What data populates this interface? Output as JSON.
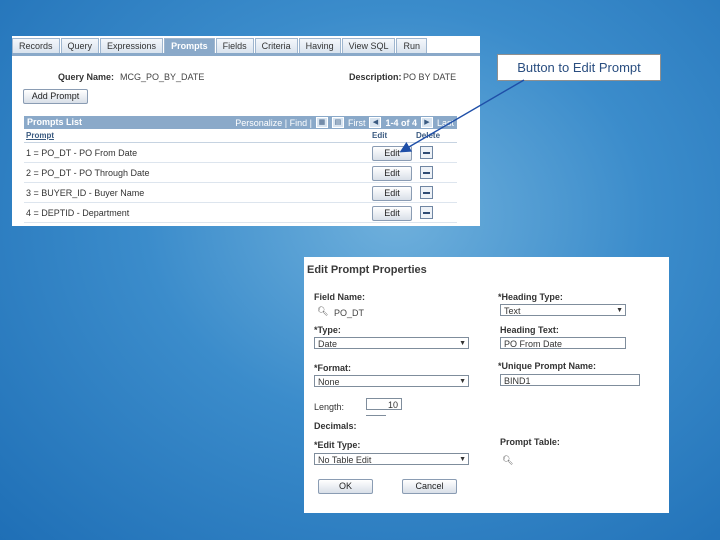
{
  "query_panel": {
    "tabs": [
      {
        "label": "Records",
        "active": false
      },
      {
        "label": "Query",
        "active": false
      },
      {
        "label": "Expressions",
        "active": false
      },
      {
        "label": "Prompts",
        "active": true
      },
      {
        "label": "Fields",
        "active": false
      },
      {
        "label": "Criteria",
        "active": false
      },
      {
        "label": "Having",
        "active": false
      },
      {
        "label": "View SQL",
        "active": false
      },
      {
        "label": "Run",
        "active": false
      }
    ],
    "query_name_label": "Query Name:",
    "query_name_value": "MCG_PO_BY_DATE",
    "description_label": "Description:",
    "description_value": "PO BY DATE",
    "add_prompt_label": "Add Prompt",
    "grid": {
      "title": "Prompts List",
      "personalize": "Personalize | Find |",
      "first": "First",
      "counter": "1-4 of 4",
      "last": "Last",
      "col_prompt": "Prompt",
      "col_edit": "Edit",
      "col_delete": "Delete",
      "edit_label": "Edit",
      "rows": [
        "1 = PO_DT - PO From Date",
        "2 = PO_DT - PO Through Date",
        "3 = BUYER_ID - Buyer Name",
        "4 = DEPTID - Department"
      ]
    }
  },
  "callout": {
    "text": "Button to Edit Prompt"
  },
  "edit_prompt": {
    "title": "Edit Prompt Properties",
    "field_name_label": "Field Name:",
    "field_name_value": "PO_DT",
    "heading_type_label": "*Heading Type:",
    "heading_type_value": "Text",
    "type_label": "*Type:",
    "type_value": "Date",
    "heading_text_label": "Heading Text:",
    "heading_text_value": "PO From Date",
    "format_label": "*Format:",
    "format_value": "None",
    "unique_prompt_label": "*Unique Prompt Name:",
    "unique_prompt_value": "BIND1",
    "length_label": "Length:",
    "length_value": "10",
    "decimals_label": "Decimals:",
    "edit_type_label": "*Edit Type:",
    "edit_type_value": "No Table Edit",
    "prompt_table_label": "Prompt Table:",
    "ok_label": "OK",
    "cancel_label": "Cancel"
  },
  "colors": {
    "background": "#3b8ccb",
    "header_bar": "#8aa9c9",
    "callout_text": "#2a4e80",
    "arrow": "#1f4fa8"
  }
}
